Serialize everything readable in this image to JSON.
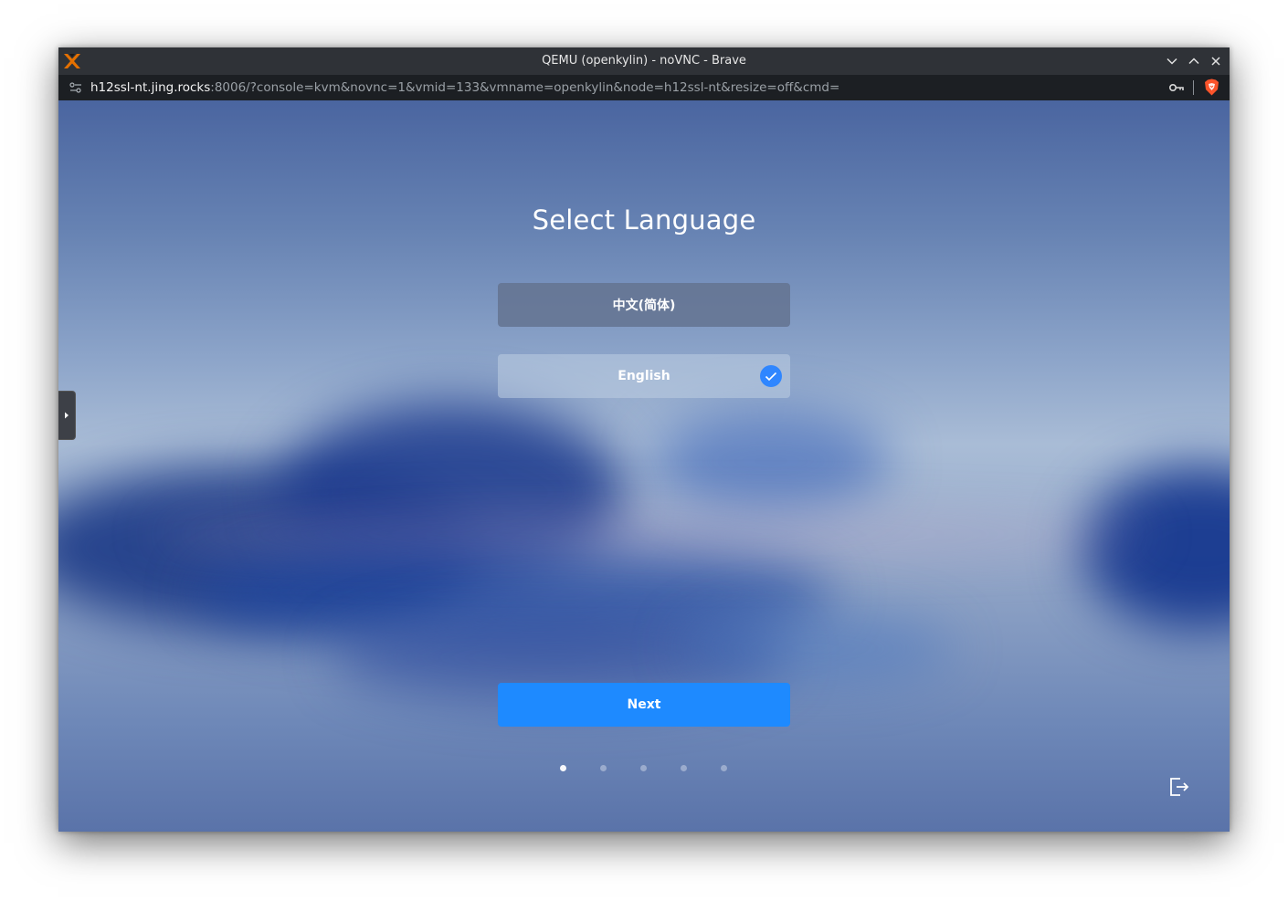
{
  "window": {
    "title": "QEMU (openkylin) - noVNC - Brave",
    "controls": [
      "minimize-icon",
      "maximize-icon",
      "close-icon"
    ]
  },
  "addressbar": {
    "url_host": "h12ssl-nt.jing.rocks",
    "url_rest": ":8006/?console=kvm&novnc=1&vmid=133&vmname=openkylin&node=h12ssl-nt&resize=off&cmd="
  },
  "installer": {
    "title": "Select Language",
    "languages": [
      {
        "label": "中文(简体)",
        "selected": false
      },
      {
        "label": "English",
        "selected": true
      }
    ],
    "next_label": "Next",
    "steps_total": 5,
    "current_step": 1
  },
  "colors": {
    "accent": "#1e8aff",
    "check": "#2f86ff",
    "titlebar": "#2f3237",
    "addressbar": "#1c1f23"
  }
}
